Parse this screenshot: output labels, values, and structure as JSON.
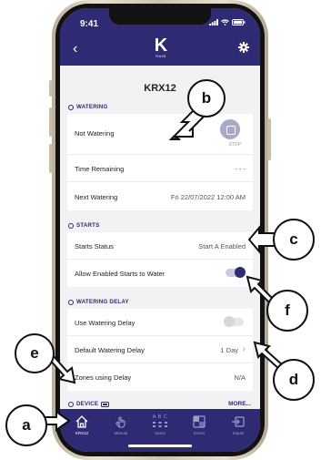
{
  "status_bar": {
    "time": "9:41"
  },
  "header": {
    "logo_letter": "K",
    "logo_sub": "RAIN"
  },
  "device": {
    "name": "KRX12"
  },
  "watering": {
    "label": "WATERING",
    "status": "Not Watering",
    "stop_label": "STOP",
    "time_remaining_label": "Time Remaining",
    "time_remaining_value": "- - -",
    "next_watering_label": "Next Watering",
    "next_watering_value": "Fri 22/07/2022 12:00 AM"
  },
  "starts": {
    "label": "STARTS",
    "status_label": "Starts Status",
    "status_value": "Start A Enabled",
    "allow_label": "Allow Enabled Starts to Water",
    "allow_on": true
  },
  "delay": {
    "label": "WATERING DELAY",
    "use_label": "Use Watering Delay",
    "use_on": false,
    "default_label": "Default Watering Delay",
    "default_value": "1 Day",
    "zones_label": "Zones using Delay",
    "zones_value": "N/A"
  },
  "device_section": {
    "label": "DEVICE",
    "more": "MORE..."
  },
  "tabs": [
    {
      "label": "KRX12",
      "icon": "home-icon"
    },
    {
      "label": "Manual",
      "icon": "hand-icon"
    },
    {
      "label": "Starts",
      "icon": "abc-icon"
    },
    {
      "label": "Zones",
      "icon": "zones-icon"
    },
    {
      "label": "Inputs",
      "icon": "inputs-icon"
    }
  ],
  "starts_tab_glyph": "A B C",
  "callouts": {
    "a": "a",
    "b": "b",
    "c": "c",
    "d": "d",
    "e": "e",
    "f": "f"
  },
  "colors": {
    "header": "#2e2a73",
    "accent": "#2e2a73",
    "background": "#f2f2f5"
  }
}
